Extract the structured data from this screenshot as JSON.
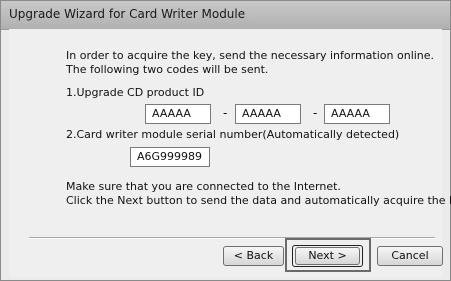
{
  "window": {
    "title": "Upgrade Wizard for Card Writer Module"
  },
  "intro": {
    "line1": "In order to acquire the key, send the necessary information online.",
    "line2": "The following two codes will be sent."
  },
  "product_id": {
    "label": "1.Upgrade CD product ID",
    "parts": [
      "AAAAA",
      "AAAAA",
      "AAAAA"
    ],
    "separator": "-"
  },
  "serial": {
    "label": "2.Card writer module serial number(Automatically detected)",
    "value": "A6G999989"
  },
  "instructions": {
    "line1": "Make sure that you are connected to the Internet.",
    "line2": "Click the Next button to send the data and automatically acquire the key."
  },
  "buttons": {
    "back": "< Back",
    "next": "Next >",
    "cancel": "Cancel"
  }
}
